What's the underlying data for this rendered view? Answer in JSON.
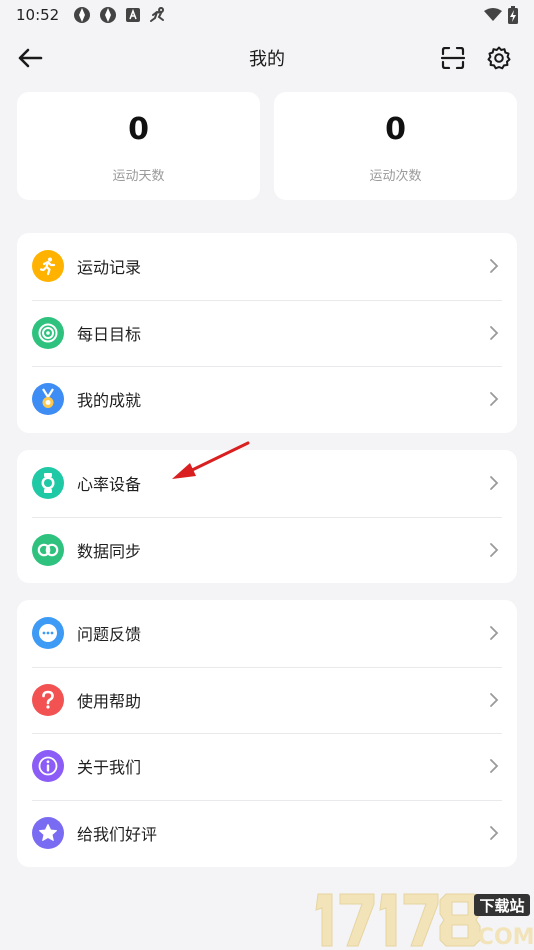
{
  "status_bar": {
    "time": "10:52"
  },
  "header": {
    "title": "我的"
  },
  "stats": [
    {
      "value": "0",
      "label": "运动天数"
    },
    {
      "value": "0",
      "label": "运动次数"
    }
  ],
  "groups": [
    {
      "items": [
        {
          "label": "运动记录",
          "icon": "running-icon",
          "color": "#ffb300"
        },
        {
          "label": "每日目标",
          "icon": "target-icon",
          "color": "#2ec27e"
        },
        {
          "label": "我的成就",
          "icon": "medal-icon",
          "color": "#3d8df5"
        }
      ]
    },
    {
      "items": [
        {
          "label": "心率设备",
          "icon": "watch-icon",
          "color": "#20c9a5"
        },
        {
          "label": "数据同步",
          "icon": "sync-icon",
          "color": "#2ec27e"
        }
      ]
    },
    {
      "items": [
        {
          "label": "问题反馈",
          "icon": "feedback-icon",
          "color": "#3d9af5"
        },
        {
          "label": "使用帮助",
          "icon": "help-icon",
          "color": "#f25252"
        },
        {
          "label": "关于我们",
          "icon": "info-icon",
          "color": "#8b5cf6"
        },
        {
          "label": "给我们好评",
          "icon": "star-icon",
          "color": "#7a6cf2"
        }
      ]
    }
  ],
  "watermark": {
    "site": "17178",
    "tag": "下载站",
    "domain": ".COM"
  }
}
